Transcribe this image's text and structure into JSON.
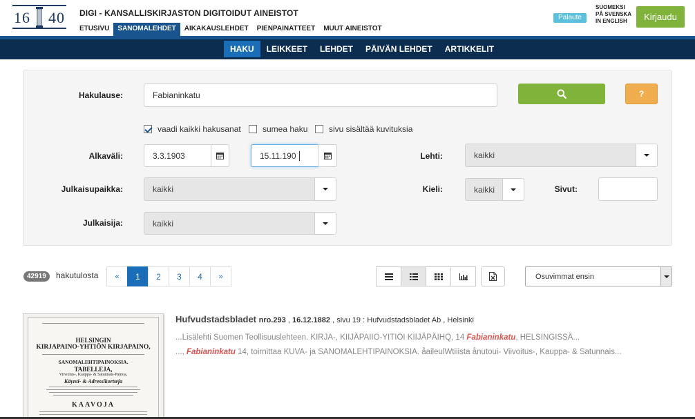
{
  "header": {
    "logo_left": "16",
    "logo_right": "40",
    "site_title": "DIGI - KANSALLISKIRJASTON DIGITOIDUT AINEISTOT",
    "nav": [
      {
        "label": "ETUSIVU"
      },
      {
        "label": "SANOMALEHDET"
      },
      {
        "label": "AIKAKAUSLEHDET"
      },
      {
        "label": "PIENPAINATTEET"
      },
      {
        "label": "MUUT AINEISTOT"
      }
    ],
    "feedback_label": "Palaute",
    "languages": [
      "SUOMEKSI",
      "PÅ SVENSKA",
      "IN ENGLISH"
    ],
    "login_label": "Kirjaudu"
  },
  "subnav": [
    {
      "label": "HAKU"
    },
    {
      "label": "LEIKKEET"
    },
    {
      "label": "LEHDET"
    },
    {
      "label": "PÄIVÄN LEHDET"
    },
    {
      "label": "ARTIKKELIT"
    }
  ],
  "search": {
    "query_label": "Hakulause:",
    "query_value": "Fabianinkatu",
    "help_label": "?",
    "checkboxes": [
      {
        "label": "vaadi kaikki hakusanat",
        "checked": true
      },
      {
        "label": "sumea haku",
        "checked": false
      },
      {
        "label": "sivu sisältää kuvituksia",
        "checked": false
      }
    ],
    "date_label": "Alkaväli:",
    "date_start": "3.3.1903",
    "date_end": "15.11.190",
    "paper_label": "Lehti:",
    "paper_value": "kaikki",
    "place_label": "Julkaisupaikka:",
    "place_value": "kaikki",
    "language_label": "Kieli:",
    "language_value": "kaikki",
    "pages_label": "Sivut:",
    "pages_value": "",
    "publisher_label": "Julkaisija:",
    "publisher_value": "kaikki"
  },
  "results": {
    "count": "42919",
    "count_label": "hakutulosta",
    "pager": [
      "«",
      "1",
      "2",
      "3",
      "4",
      "»"
    ],
    "sort_value": "Osuvimmat ensin",
    "items": [
      {
        "title": "Hufvudstadsbladet",
        "issue": "nro.293",
        "date": "16.12.1882",
        "page": "sivu 19",
        "publisher": "Hufvudstadsbladet Ab",
        "city": "Helsinki",
        "snippet1_pre": "...Lisälehti Suomen Teollisuuslehteen. KIRJA-, KIIJÄPAIIO-YITIÖI KIIJÄPÄIHQ, 14 ",
        "snippet1_hl": "Fabianinkatu",
        "snippet1_post": ", HELSINGISSÄ...",
        "snippet2_pre": "..., ",
        "snippet2_hl": "Fabianinkatu",
        "snippet2_post": " 14, toirnittaa KUVA- ja SANOMALEHTIPAINOKSIA. åaileulWtiiista ånutoui- Viivoitus-, Kauppa- & Satunnais...",
        "thumb_lines": [
          "HELSINGIN",
          "KIRJAPAINO-YHTIÖN KIRJAPAINO,",
          "SANOMALEHTIPAINOKSIA.",
          "TABELLEJA,",
          "Viivoitus-, Kauppa- & Satunnais-Painoa,",
          "Käynti- & Adressikortteja",
          "KAAVOJA"
        ]
      }
    ]
  }
}
